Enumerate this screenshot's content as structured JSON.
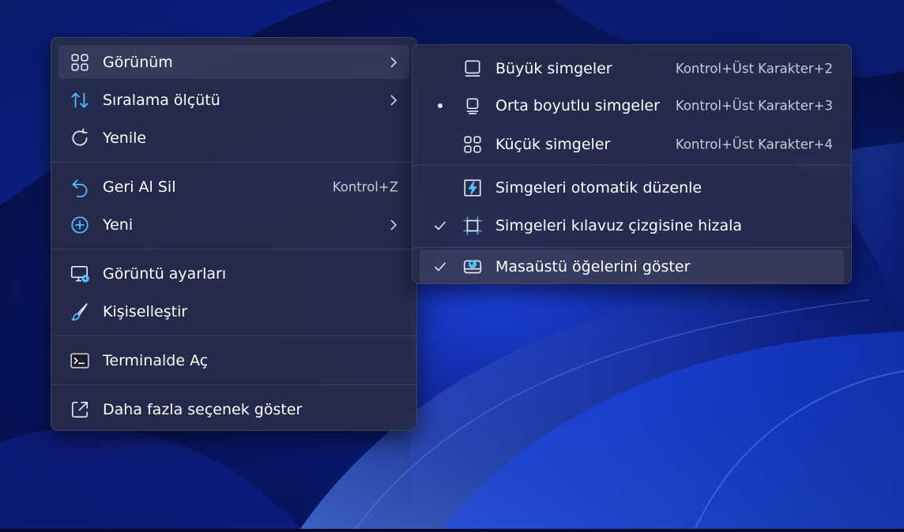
{
  "main_menu": {
    "items": [
      {
        "label": "Görünüm"
      },
      {
        "label": "Sıralama ölçütü"
      },
      {
        "label": "Yenile"
      },
      {
        "label": "Geri Al Sil",
        "shortcut": "Kontrol+Z"
      },
      {
        "label": "Yeni"
      },
      {
        "label": "Görüntü ayarları"
      },
      {
        "label": "Kişiselleştir"
      },
      {
        "label": "Terminalde Aç"
      },
      {
        "label": "Daha fazla seçenek göster"
      }
    ]
  },
  "sub_menu": {
    "items": [
      {
        "label": "Büyük simgeler",
        "shortcut": "Kontrol+Üst Karakter+2"
      },
      {
        "label": "Orta boyutlu simgeler",
        "shortcut": "Kontrol+Üst Karakter+3"
      },
      {
        "label": "Küçük simgeler",
        "shortcut": "Kontrol+Üst Karakter+4"
      },
      {
        "label": "Simgeleri otomatik düzenle"
      },
      {
        "label": "Simgeleri kılavuz çizgisine hizala"
      },
      {
        "label": "Masaüstü öğelerini göster"
      }
    ]
  },
  "icons": {
    "main": [
      "grid-icon",
      "sort-icon",
      "refresh-icon",
      "undo-icon",
      "add-circle-icon",
      "display-settings-icon",
      "brush-icon",
      "terminal-icon",
      "open-external-icon"
    ],
    "sub": [
      "large-icons-icon",
      "medium-icons-icon",
      "small-icons-icon",
      "auto-arrange-icon",
      "align-grid-icon",
      "desktop-items-icon"
    ]
  },
  "colors": {
    "menu_background": "#282c4a",
    "text": "#ffffff",
    "shortcut_text": "#c9cbd6",
    "accent": "#4cc2ff"
  }
}
